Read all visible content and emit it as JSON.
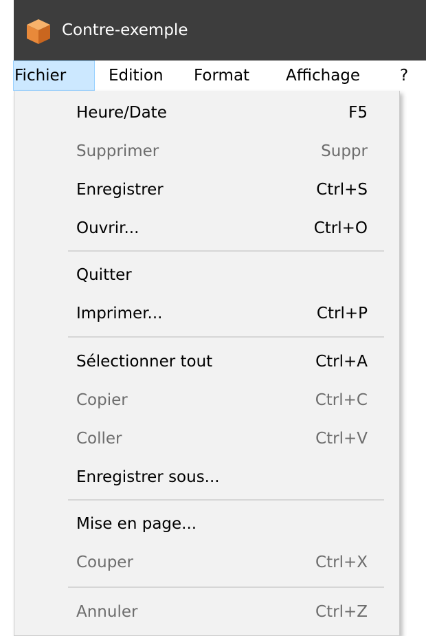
{
  "window": {
    "title": "Contre-exemple",
    "icon": "orange-cube-icon"
  },
  "menubar": {
    "items": [
      {
        "label": "Fichier",
        "active": true
      },
      {
        "label": "Edition"
      },
      {
        "label": "Format"
      },
      {
        "label": "Affichage"
      },
      {
        "label": "?"
      }
    ]
  },
  "menu": {
    "items": [
      {
        "label": "Heure/Date",
        "shortcut": "F5",
        "enabled": true
      },
      {
        "label": "Supprimer",
        "shortcut": "Suppr",
        "enabled": false
      },
      {
        "label": "Enregistrer",
        "shortcut": "Ctrl+S",
        "enabled": true
      },
      {
        "label": "Ouvrir...",
        "shortcut": "Ctrl+O",
        "enabled": true
      },
      {
        "label": "Quitter",
        "shortcut": "",
        "enabled": true
      },
      {
        "label": "Imprimer...",
        "shortcut": "Ctrl+P",
        "enabled": true
      },
      {
        "label": "Sélectionner tout",
        "shortcut": "Ctrl+A",
        "enabled": true
      },
      {
        "label": "Copier",
        "shortcut": "Ctrl+C",
        "enabled": false
      },
      {
        "label": "Coller",
        "shortcut": "Ctrl+V",
        "enabled": false
      },
      {
        "label": "Enregistrer sous...",
        "shortcut": "",
        "enabled": true
      },
      {
        "label": "Mise en page...",
        "shortcut": "",
        "enabled": true
      },
      {
        "label": "Couper",
        "shortcut": "Ctrl+X",
        "enabled": false
      },
      {
        "label": "Annuler",
        "shortcut": "Ctrl+Z",
        "enabled": false
      }
    ]
  },
  "colors": {
    "titlebar": "#3d3d3d",
    "menu_background": "#f2f2f2",
    "active_menubar_item": "#cce8ff",
    "disabled_text": "#6d6d6d",
    "icon_orange": "#e8893a"
  }
}
